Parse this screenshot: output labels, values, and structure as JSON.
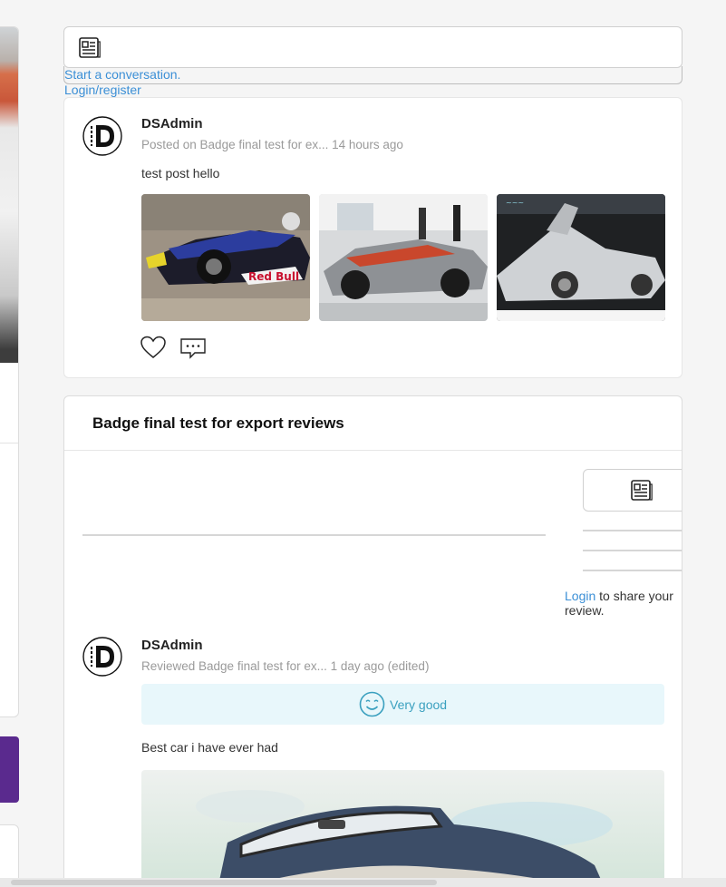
{
  "composer": {
    "icon": "news-icon",
    "prompt": "Start a conversation.",
    "login": "Login/register"
  },
  "post": {
    "author": "DSAdmin",
    "meta": "Posted on Badge final test for ex...  14 hours ago",
    "body": "test post hello",
    "images": [
      "red-bull-race-car-photo",
      "grey-sports-car-photo",
      "silver-supercar-photo"
    ],
    "actions": [
      "heart-icon",
      "comment-icon"
    ]
  },
  "reviews": {
    "title": "Badge final test for export reviews",
    "login_link": "Login",
    "share_suffix": " to share your review.",
    "review": {
      "author": "DSAdmin",
      "meta": "Reviewed Badge final test for ex...  1 day ago (edited)",
      "rating_label": "Very good",
      "rating_icon": "smile-icon",
      "body": "Best car i have ever had",
      "image": "classic-convertible-photo"
    }
  },
  "colors": {
    "link": "#3b8fd6",
    "rating_bg": "#e8f7fb",
    "rating_text": "#3aa0bf",
    "accent_purple": "#5a2a8e"
  }
}
